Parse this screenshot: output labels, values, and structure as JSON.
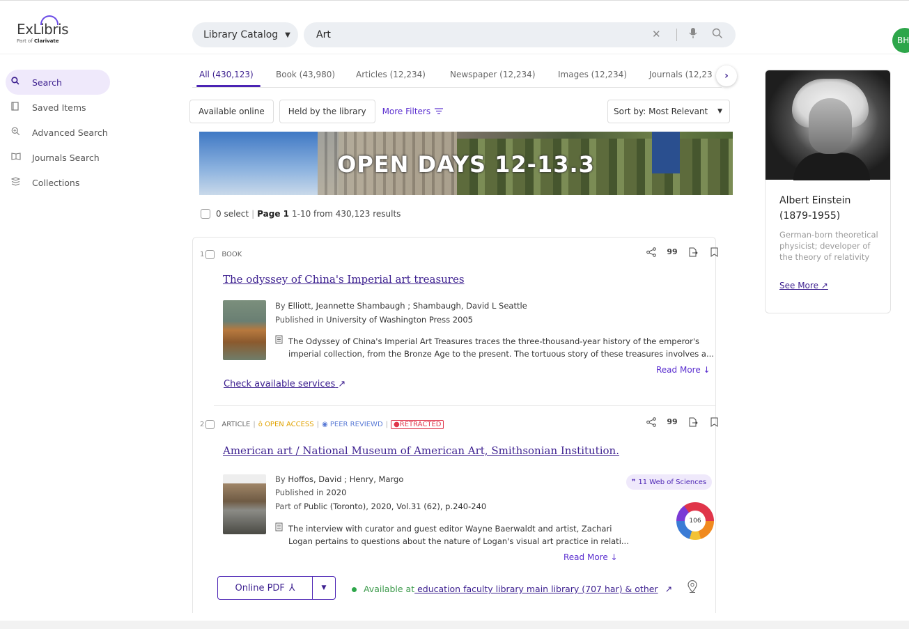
{
  "header": {
    "logo_main": "ExLibris",
    "logo_sub_prefix": "Part of ",
    "logo_sub_brand": "Clarivate",
    "catalog_label": "Library Catalog",
    "search_value": "Art",
    "avatar_initials": "BH"
  },
  "sidebar": {
    "items": [
      {
        "label": "Search"
      },
      {
        "label": "Saved Items"
      },
      {
        "label": "Advanced Search"
      },
      {
        "label": "Journals Search"
      },
      {
        "label": "Collections"
      }
    ]
  },
  "tabs": [
    {
      "label": "All (430,123)"
    },
    {
      "label": "Book (43,980)"
    },
    {
      "label": "Articles  (12,234)"
    },
    {
      "label": "Newspaper  (12,234)"
    },
    {
      "label": "Images  (12,234)"
    },
    {
      "label": "Journals  (12,23"
    }
  ],
  "filters": {
    "available_online": "Available online",
    "held_by_library": "Held by the library",
    "more_filters": "More Filters",
    "sort_label": "Sort by: Most Relevant"
  },
  "banner": {
    "text": "OPEN DAYS 12-13.3"
  },
  "select_row": {
    "selected": "0 select",
    "page_label": "Page 1",
    "range": "1-10 from 430,123 results"
  },
  "results": [
    {
      "num": "1",
      "type": "BOOK",
      "title": "The odyssey of China's Imperial art treasures",
      "authors_prefix": "By ",
      "authors": "Elliott, Jeannette Shambaugh ; Shambaugh, David L Seattle",
      "published_prefix": "Published in ",
      "published": "University of Washington Press 2005",
      "desc_line1": "The Odyssey of China's Imperial Art Treasures traces the three-thousand-year history of the emperor's",
      "desc_line2": "imperial collection, from the Bronze Age to the present. The tortuous story of these treasures involves a...",
      "read_more": "Read More",
      "check_services": "Check available services"
    },
    {
      "num": "2",
      "type": "ARTICLE",
      "open_access": "OPEN ACCESS",
      "peer_reviewed": "PEER REVIEWD",
      "retracted": "RETRACTED",
      "title": "American art / National Museum of American Art, Smithsonian Institution.",
      "authors_prefix": "By ",
      "authors": "Hoffos, David ; Henry, Margo",
      "published_prefix": "Published in ",
      "published": "2020",
      "part_of_prefix": "Part of ",
      "part_of": "Public (Toronto), 2020, Vol.31 (62), p.240-240",
      "desc_line1": "The interview with curator and guest editor Wayne Baerwaldt and artist, Zachari",
      "desc_line2": "Logan pertains to questions about the nature of Logan's visual art practice in relati...",
      "read_more": "Read More",
      "wos": "11 Web of Sciences",
      "altmetric": "106",
      "pdf_label": "Online PDF",
      "available_prefix": "Available at",
      "available_link": " education faculty library main library (707 har) & other"
    }
  ],
  "person": {
    "name": "Albert Einstein (1879-1955)",
    "description": "German-born theoretical physicist; developer of the theory of relativity",
    "see_more": "See More"
  },
  "colors": {
    "accent": "#3c1f8f",
    "accent_light": "#efe9fb",
    "available_green": "#2da64a",
    "retracted_red": "#e0354a"
  },
  "icons": {
    "search": "search-icon",
    "saved": "bookmark-icon",
    "advanced": "advanced-search-icon",
    "journals": "book-open-icon",
    "collections": "collections-icon"
  }
}
